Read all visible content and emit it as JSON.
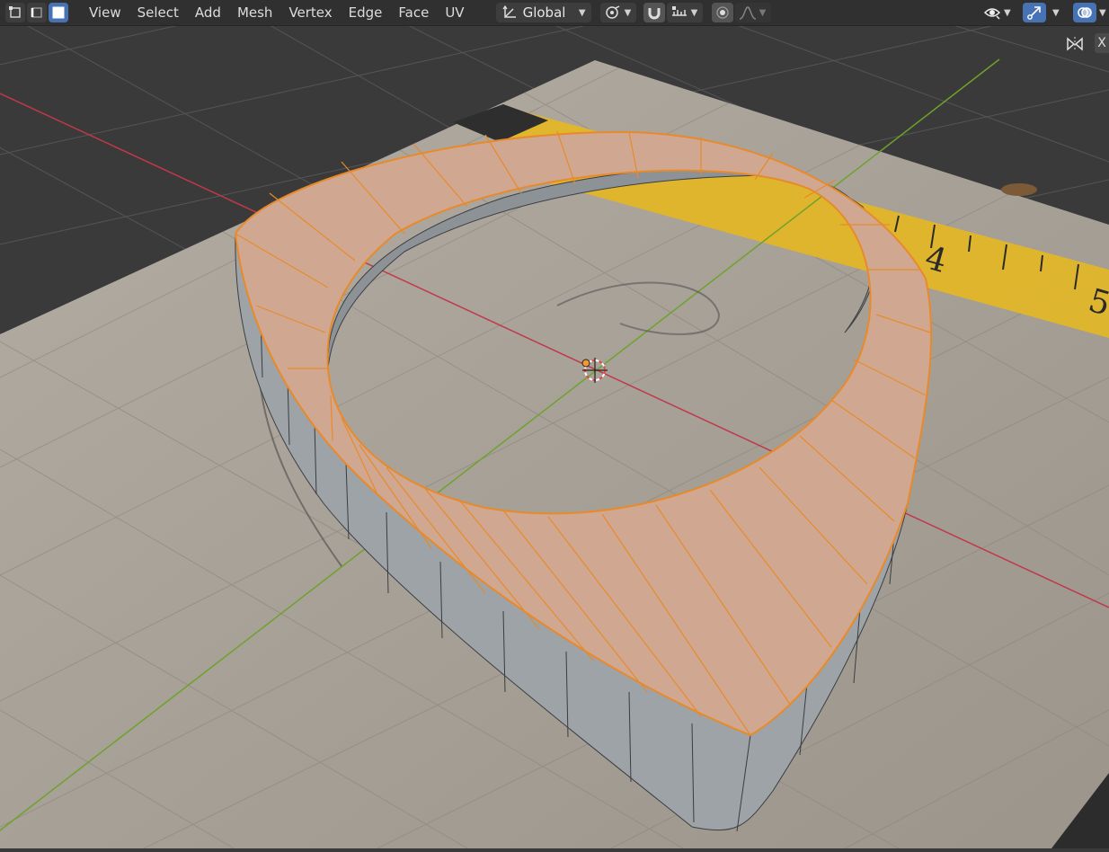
{
  "header": {
    "menus": [
      "View",
      "Select",
      "Add",
      "Mesh",
      "Vertex",
      "Edge",
      "Face",
      "UV"
    ],
    "transform_orientation": "Global",
    "select_mode_icons": [
      "vertex-select-icon",
      "edge-select-icon",
      "face-select-icon"
    ],
    "right_icons": [
      "visibility-icon",
      "gizmo-icon",
      "overlay-icon"
    ]
  },
  "viewport": {
    "colors": {
      "background": "#3a3a3a",
      "grid_line": "#555555",
      "x_axis": "#c0384a",
      "y_axis": "#6ea22b",
      "face_selected": "#d0a892",
      "edge_selected": "#e88a2a",
      "wall": "#9ea3a7",
      "wall_edge": "#3c3f42",
      "paper": "#a39d94",
      "tape": "#e5b92c"
    },
    "tape_numbers": [
      "4",
      "5"
    ],
    "tool_icon": "x-mirror-icon",
    "tool_label": "X"
  }
}
